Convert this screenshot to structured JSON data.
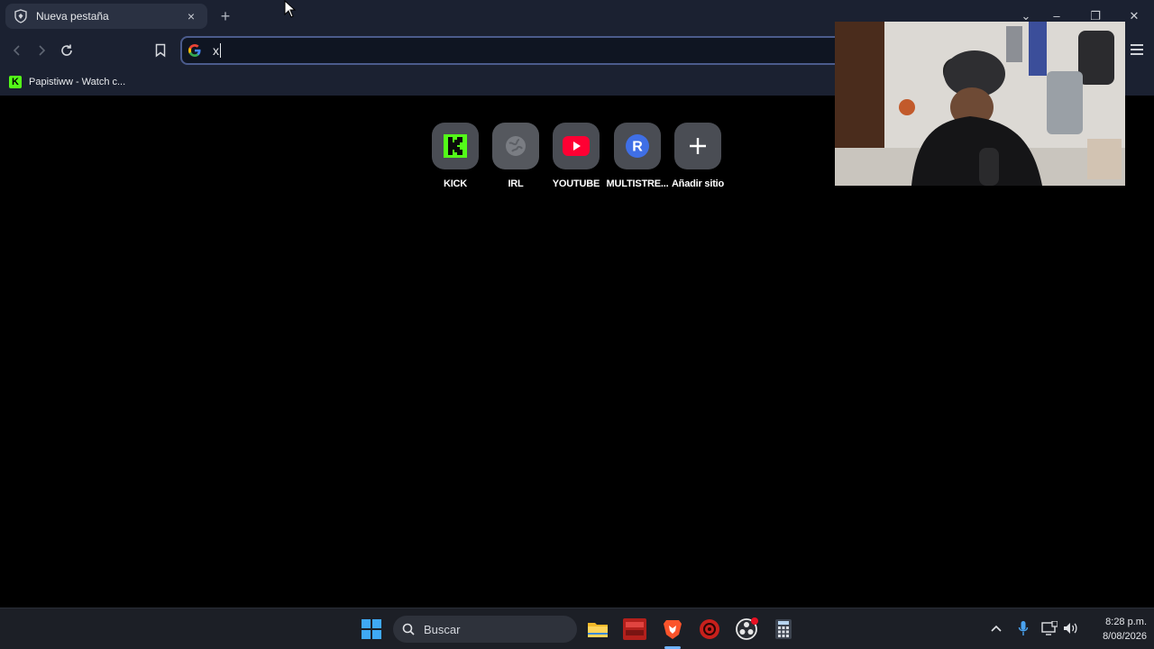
{
  "browser": {
    "tab": {
      "title": "Nueva pestaña",
      "close": "×"
    },
    "new_tab": "+",
    "window_controls": {
      "chevron": "⌄",
      "minimize": "–",
      "restore": "❐",
      "close": "✕"
    },
    "address_bar": {
      "value": "x"
    },
    "bookmark": {
      "label": "Papistiww - Watch c..."
    }
  },
  "speed_dial": [
    {
      "label": "KICK",
      "icon": "kick-icon",
      "color": "#53fc18"
    },
    {
      "label": "IRL",
      "icon": "globe-icon",
      "color": "#8a8d93"
    },
    {
      "label": "YOUTUBE",
      "icon": "youtube-icon",
      "color": "#ff0033"
    },
    {
      "label": "MULTISTRE...",
      "icon": "r-icon",
      "color": "#3f6fe6"
    },
    {
      "label": "Añadir sitio",
      "icon": "plus-icon",
      "color": "#ffffff"
    }
  ],
  "taskbar": {
    "search_label": "Buscar",
    "apps": [
      "windows-start-icon",
      "file-explorer-icon",
      "voicemeeter-icon",
      "brave-icon",
      "davinci-icon",
      "obs-icon",
      "calculator-icon"
    ],
    "clock": {
      "time": "8:28 p.m.",
      "date": "8/08/2026"
    }
  }
}
